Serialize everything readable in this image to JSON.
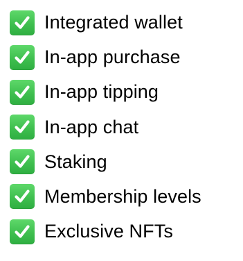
{
  "features": {
    "check_icon": "white-check-mark-on-green-square",
    "check_color": "#3fbf4f",
    "items": [
      {
        "label": "Integrated wallet"
      },
      {
        "label": "In-app purchase"
      },
      {
        "label": "In-app tipping"
      },
      {
        "label": "In-app chat"
      },
      {
        "label": "Staking"
      },
      {
        "label": "Membership levels"
      },
      {
        "label": "Exclusive NFTs"
      }
    ]
  }
}
